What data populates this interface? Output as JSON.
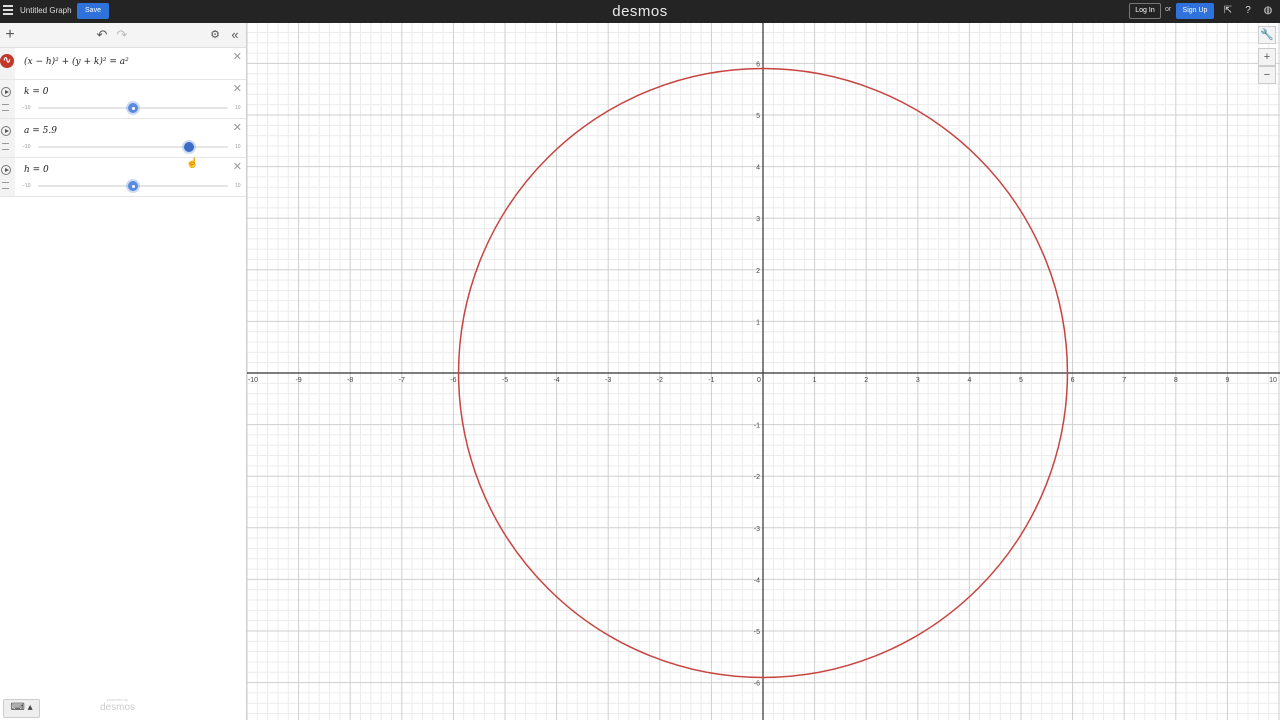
{
  "topbar": {
    "graph_title": "Untitled Graph",
    "save_label": "Save",
    "logo": "desmos",
    "login_label": "Log In",
    "or_text": "or",
    "signup_label": "Sign Up"
  },
  "expressions": [
    {
      "type": "equation",
      "latex_text": "(x − h)² + (y + k)² = a²",
      "color": "#c74440"
    },
    {
      "type": "slider",
      "variable": "k",
      "label": "k = 0",
      "value": 0,
      "min": -10,
      "max": 10,
      "min_label": "−10",
      "max_label": "10"
    },
    {
      "type": "slider",
      "variable": "a",
      "label": "a = 5.9",
      "value": 5.9,
      "min": -10,
      "max": 10,
      "min_label": "−10",
      "max_label": "10"
    },
    {
      "type": "slider",
      "variable": "h",
      "label": "h = 0",
      "value": 0,
      "min": -10,
      "max": 10,
      "min_label": "−10",
      "max_label": "10"
    }
  ],
  "powered_by": {
    "small": "powered by",
    "name": "desmos"
  },
  "graph": {
    "xlim": [
      -10,
      10
    ],
    "ylim": [
      -6,
      6
    ],
    "x_ticks": [
      "-10",
      "-9",
      "-8",
      "-7",
      "-6",
      "-5",
      "-4",
      "-3",
      "-2",
      "-1",
      "0",
      "1",
      "2",
      "3",
      "4",
      "5",
      "6",
      "7",
      "8",
      "9",
      "10"
    ],
    "y_ticks": [
      "6",
      "5",
      "4",
      "3",
      "2",
      "1",
      "-1",
      "-2",
      "-3",
      "-4",
      "-5",
      "-6"
    ],
    "curve": {
      "type": "circle",
      "center": [
        0,
        0
      ],
      "radius": 5.9,
      "color": "#c74440"
    }
  }
}
